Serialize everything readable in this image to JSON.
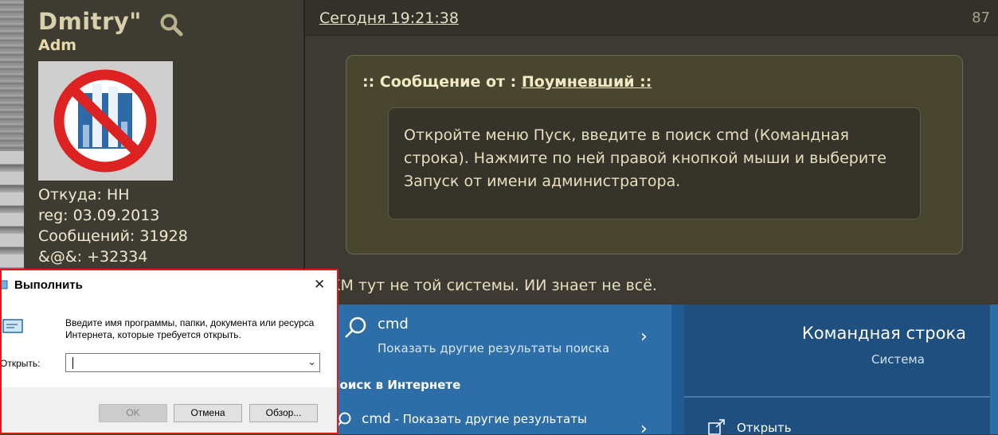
{
  "user": {
    "name": "Dmitry\"",
    "rank": "Adm",
    "from": "Откуда: НН",
    "reg": "reg: 03.09.2013",
    "messages": "Сообщений: 31928",
    "rep": "&@&: +32334"
  },
  "post": {
    "date": "Сегодня 19:21:38",
    "number": "87",
    "quote_prefix": ":: Сообщение от : ",
    "quote_author": "Поумневший ::",
    "quote_text": "Откройте меню Пуск, введите в поиск cmd (Командная строка). Нажмите по ней правой кнопкой мыши и выберите Запуск от имени администратора.",
    "reply_line": "КМ тут не той системы. ИИ знает не всё."
  },
  "windows_search": {
    "query": "cmd",
    "query_sub": "Показать другие результаты поиска",
    "section": "Поиск в Интернете",
    "web_query": "cmd",
    "web_sub": " - Показать другие результаты",
    "result_title": "Командная строка",
    "result_type": "Система",
    "open_label": "Открыть"
  },
  "run_dialog": {
    "title": "Выполнить",
    "description": "Введите имя программы, папки, документа или ресурса Интернета, которые требуется открыть.",
    "open_label": "Открыть:",
    "input_value": "",
    "ok_label": "OK",
    "cancel_label": "Отмена",
    "browse_label": "Обзор..."
  },
  "colors": {
    "accent_red": "#e01818",
    "win_blue": "#2e6ea8",
    "forum_bg": "#3c3a32"
  }
}
